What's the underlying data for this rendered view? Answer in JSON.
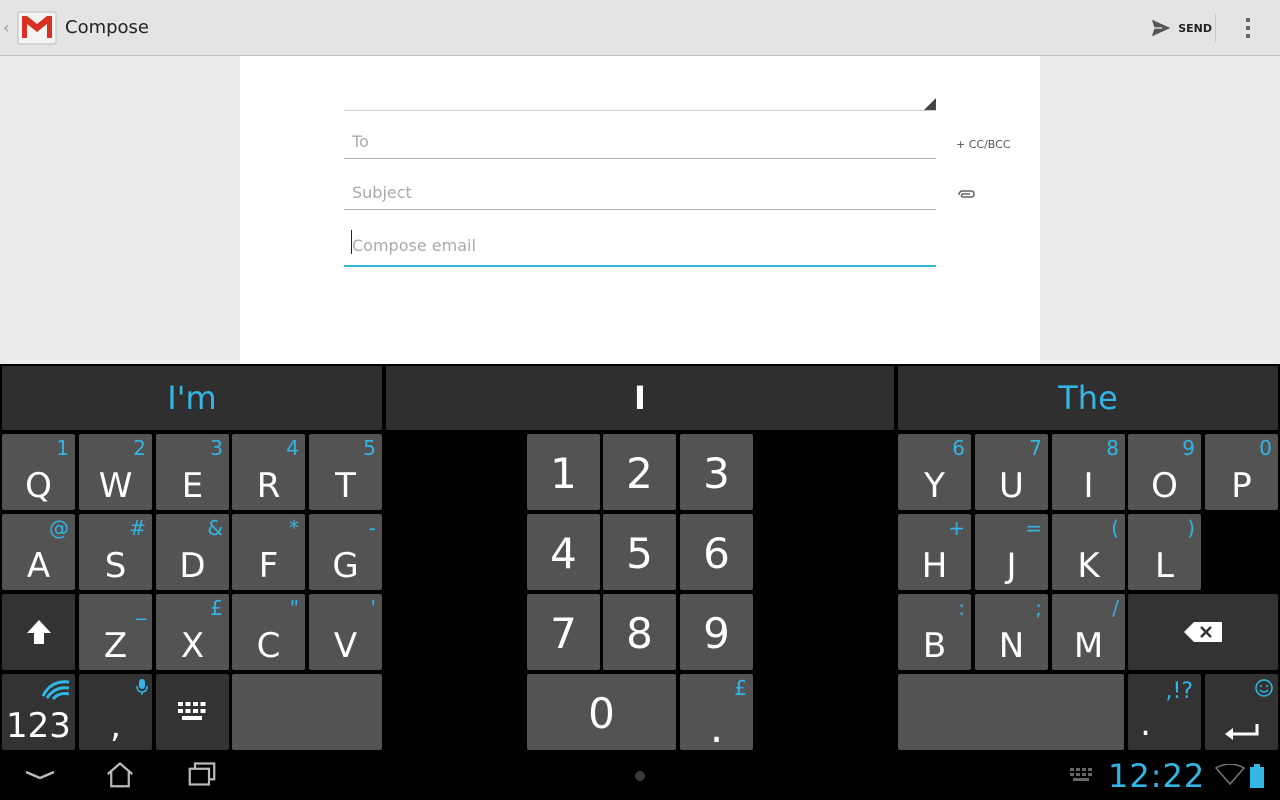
{
  "action_bar": {
    "title": "Compose",
    "send_label": "SEND"
  },
  "compose": {
    "to_placeholder": "To",
    "cc_bcc_label": "+ CC/BCC",
    "subject_placeholder": "Subject",
    "body_placeholder": "Compose email"
  },
  "keyboard": {
    "suggestions": [
      "I'm",
      "I",
      "The"
    ],
    "left_rows": [
      [
        {
          "label": "Q",
          "hint": "1"
        },
        {
          "label": "W",
          "hint": "2"
        },
        {
          "label": "E",
          "hint": "3"
        },
        {
          "label": "R",
          "hint": "4"
        },
        {
          "label": "T",
          "hint": "5"
        }
      ],
      [
        {
          "label": "A",
          "hint": "@"
        },
        {
          "label": "S",
          "hint": "#"
        },
        {
          "label": "D",
          "hint": "&"
        },
        {
          "label": "F",
          "hint": "*"
        },
        {
          "label": "G",
          "hint": "-"
        }
      ],
      [
        {
          "label": "Z",
          "hint": "_"
        },
        {
          "label": "X",
          "hint": "£"
        },
        {
          "label": "C",
          "hint": "\""
        },
        {
          "label": "V",
          "hint": "'"
        }
      ]
    ],
    "right_rows": [
      [
        {
          "label": "Y",
          "hint": "6"
        },
        {
          "label": "U",
          "hint": "7"
        },
        {
          "label": "I",
          "hint": "8"
        },
        {
          "label": "O",
          "hint": "9"
        },
        {
          "label": "P",
          "hint": "0"
        }
      ],
      [
        {
          "label": "H",
          "hint": "+"
        },
        {
          "label": "J",
          "hint": "="
        },
        {
          "label": "K",
          "hint": "("
        },
        {
          "label": "L",
          "hint": ")"
        }
      ],
      [
        {
          "label": "B",
          "hint": ":"
        },
        {
          "label": "N",
          "hint": ";"
        },
        {
          "label": "M",
          "hint": "/"
        }
      ]
    ],
    "numpad": [
      "1",
      "2",
      "3",
      "4",
      "5",
      "6",
      "7",
      "8",
      "9",
      "0"
    ],
    "numpad_dot": ".",
    "numpad_dot_hint": "£",
    "symbols_label": "123",
    "comma_label": ",",
    "punct_label": ".",
    "punct_hint": ",!?"
  },
  "status_bar": {
    "time": "12:22"
  },
  "colors": {
    "accent": "#33b5e5",
    "key": "#535353",
    "key_dark": "#333333"
  }
}
